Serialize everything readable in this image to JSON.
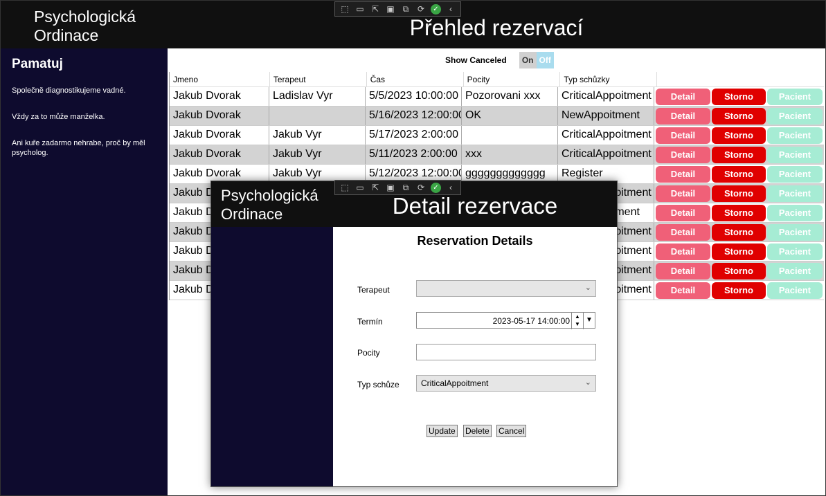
{
  "main": {
    "app_name_line1": "Psychologická",
    "app_name_line2": "Ordinace",
    "page_title": "Přehled rezervací",
    "sidebar": {
      "heading": "Pamatuj",
      "notes": [
        "Společně diagnostikujeme vadné.",
        "Vždy za to může manželka.",
        "Ani kuře zadarmo nehrabe, proč by měl psycholog."
      ]
    },
    "toggle": {
      "label": "Show Canceled",
      "on": "On",
      "off": "Off"
    },
    "grid": {
      "columns": [
        "Jmeno",
        "Terapeut",
        "Čas",
        "Pocity",
        "Typ schůzky"
      ],
      "buttons": {
        "detail": "Detail",
        "storno": "Storno",
        "pacient": "Pacient"
      },
      "rows": [
        {
          "jmeno": "Jakub Dvorak",
          "terapeut": "Ladislav Vyr",
          "cas": "5/5/2023 10:00:00",
          "pocity": "Pozorovani xxx",
          "typ": "CriticalAppoitment"
        },
        {
          "jmeno": "Jakub Dvorak",
          "terapeut": "",
          "cas": "5/16/2023 12:00:00",
          "pocity": "OK",
          "typ": "NewAppoitment"
        },
        {
          "jmeno": "Jakub Dvorak",
          "terapeut": "Jakub Vyr",
          "cas": "5/17/2023 2:00:00",
          "pocity": "",
          "typ": "CriticalAppoitment"
        },
        {
          "jmeno": "Jakub Dvorak",
          "terapeut": "Jakub Vyr",
          "cas": "5/11/2023 2:00:00",
          "pocity": "xxx",
          "typ": "CriticalAppoitment"
        },
        {
          "jmeno": "Jakub Dvorak",
          "terapeut": "Jakub Vyr",
          "cas": "5/12/2023 12:00:00",
          "pocity": "ggggggggggggg",
          "typ": "Register"
        },
        {
          "jmeno": "Jakub D",
          "terapeut": "",
          "cas": "",
          "pocity": "",
          "typ": "CriticalAppoitment"
        },
        {
          "jmeno": "Jakub D",
          "terapeut": "",
          "cas": "",
          "pocity": "",
          "typ": "NewAppoitment"
        },
        {
          "jmeno": "Jakub D",
          "terapeut": "",
          "cas": "",
          "pocity": "",
          "typ": "CriticalAppoitment"
        },
        {
          "jmeno": "Jakub D",
          "terapeut": "",
          "cas": "",
          "pocity": "",
          "typ": "CriticalAppoitment"
        },
        {
          "jmeno": "Jakub D",
          "terapeut": "",
          "cas": "",
          "pocity": "",
          "typ": "CriticalAppoitment"
        },
        {
          "jmeno": "Jakub D",
          "terapeut": "",
          "cas": "",
          "pocity": "",
          "typ": "CriticalAppoitment"
        }
      ]
    }
  },
  "dialog": {
    "app_name_line1": "Psychologická",
    "app_name_line2": "Ordinace",
    "title": "Detail rezervace",
    "form_title": "Reservation Details",
    "fields": {
      "terapeut_label": "Terapeut",
      "terapeut_value": "",
      "termin_label": "Termín",
      "termin_value": "2023-05-17 14:00:00",
      "pocity_label": "Pocity",
      "pocity_value": "",
      "typ_label": "Typ schůze",
      "typ_value": "CriticalAppoitment"
    },
    "buttons": {
      "update": "Update",
      "delete": "Delete",
      "cancel": "Cancel"
    }
  },
  "icons": {
    "ok": "✓",
    "chevron": "⌄",
    "collapse": "‹"
  }
}
